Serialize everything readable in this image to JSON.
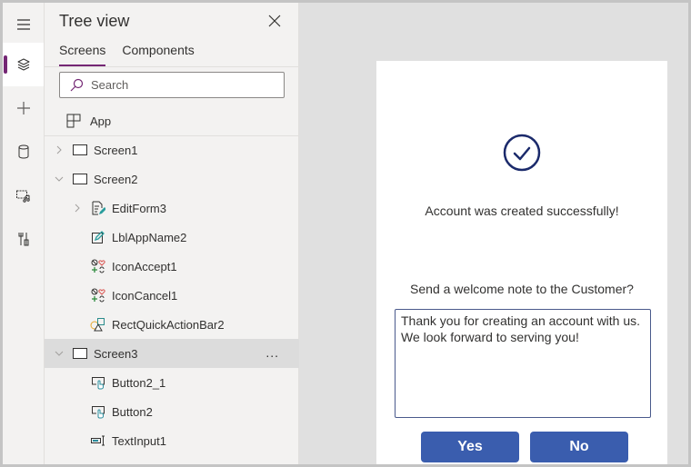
{
  "rail": {
    "items": [
      {
        "name": "menu",
        "active": false
      },
      {
        "name": "tree-view",
        "active": true
      },
      {
        "name": "insert",
        "active": false
      },
      {
        "name": "data",
        "active": false
      },
      {
        "name": "media",
        "active": false
      },
      {
        "name": "advanced-tools",
        "active": false
      }
    ]
  },
  "tree": {
    "title": "Tree view",
    "tabs": [
      {
        "label": "Screens",
        "active": true
      },
      {
        "label": "Components",
        "active": false
      }
    ],
    "search_placeholder": "Search",
    "app_label": "App",
    "nodes": [
      {
        "label": "Screen1",
        "type": "screen",
        "chevron": "right",
        "level": 0
      },
      {
        "label": "Screen2",
        "type": "screen",
        "chevron": "down",
        "level": 0
      },
      {
        "label": "EditForm3",
        "type": "form",
        "chevron": "right",
        "level": 1
      },
      {
        "label": "LblAppName2",
        "type": "label",
        "chevron": "",
        "level": 1
      },
      {
        "label": "IconAccept1",
        "type": "icon",
        "chevron": "",
        "level": 1
      },
      {
        "label": "IconCancel1",
        "type": "icon",
        "chevron": "",
        "level": 1
      },
      {
        "label": "RectQuickActionBar2",
        "type": "shape",
        "chevron": "",
        "level": 1
      },
      {
        "label": "Screen3",
        "type": "screen",
        "chevron": "down",
        "level": 0,
        "selected": true,
        "more": "..."
      },
      {
        "label": "Button2_1",
        "type": "button",
        "chevron": "",
        "level": 1
      },
      {
        "label": "Button2",
        "type": "button",
        "chevron": "",
        "level": 1
      },
      {
        "label": "TextInput1",
        "type": "textinput",
        "chevron": "",
        "level": 1
      }
    ]
  },
  "canvas": {
    "success_message": "Account was created successfully!",
    "question": "Send a welcome note to the Customer?",
    "note_value": "Thank you for creating an account with us. We look forward to serving you!",
    "yes_label": "Yes",
    "no_label": "No"
  },
  "colors": {
    "accent": "#742774",
    "button": "#3a5dae",
    "check": "#1b2a6b"
  }
}
